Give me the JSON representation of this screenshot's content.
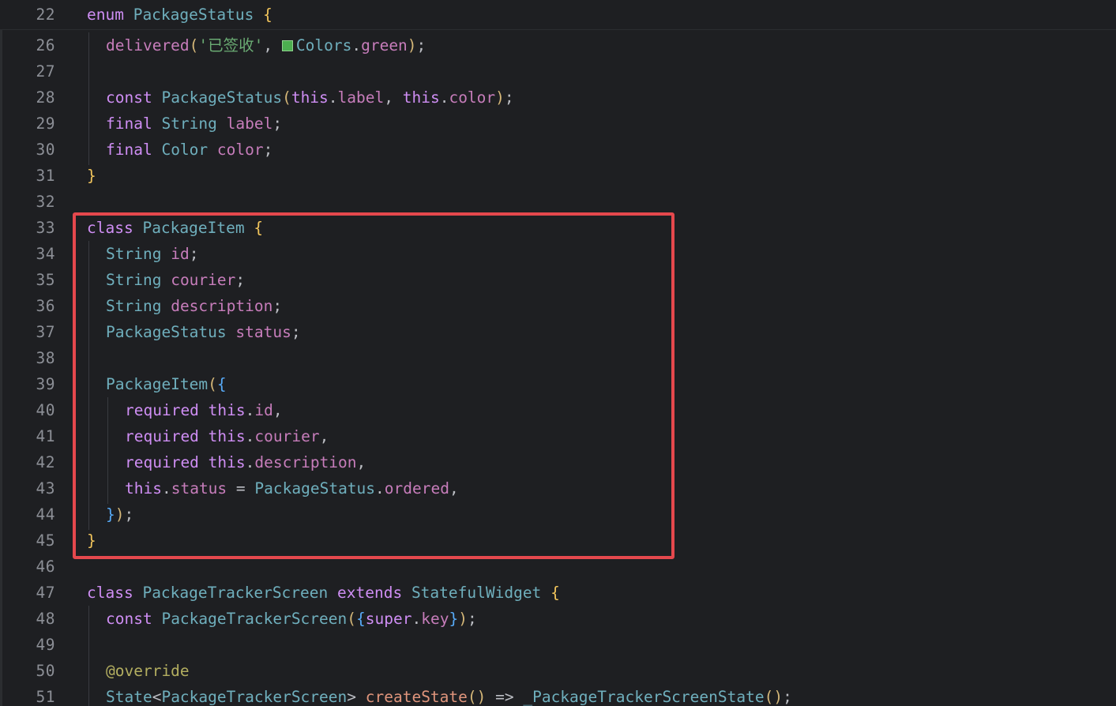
{
  "colors": {
    "background": "#1e1f22",
    "keyword": "#cf8ef4",
    "type": "#6fafbd",
    "string": "#6aab73",
    "field": "#c77dbb",
    "brace": "#f2c55c",
    "paren": "#d5b778",
    "method": "#57aaf7",
    "text": "#bcbec4",
    "function": "#e0957c",
    "annotation": "#b3ae60",
    "line_number": "#8c8f96",
    "highlight_box": "#e5484d",
    "color_swatch": "#4caf50"
  },
  "lines": [
    {
      "num": "22",
      "indent": 0,
      "sticky": true,
      "tokens": [
        {
          "t": "enum ",
          "c": "#cf8ef4"
        },
        {
          "t": "PackageStatus",
          "c": "#6fafbd"
        },
        {
          "t": " ",
          "c": "#bcbec4"
        },
        {
          "t": "{",
          "c": "#f2c55c"
        }
      ]
    },
    {
      "num": "26",
      "indent": 1,
      "tokens": [
        {
          "t": "delivered",
          "c": "#c77dbb"
        },
        {
          "t": "(",
          "c": "#d5b778"
        },
        {
          "t": "'已签收'",
          "c": "#6aab73"
        },
        {
          "t": ", ",
          "c": "#bcbec4"
        },
        {
          "swatch": "#4caf50"
        },
        {
          "t": "Colors",
          "c": "#6fafbd"
        },
        {
          "t": ".",
          "c": "#bcbec4"
        },
        {
          "t": "green",
          "c": "#c77dbb"
        },
        {
          "t": ")",
          "c": "#d5b778"
        },
        {
          "t": ";",
          "c": "#bcbec4"
        }
      ]
    },
    {
      "num": "27",
      "indent": 1,
      "tokens": []
    },
    {
      "num": "28",
      "indent": 1,
      "tokens": [
        {
          "t": "const ",
          "c": "#cf8ef4"
        },
        {
          "t": "PackageStatus",
          "c": "#6fafbd"
        },
        {
          "t": "(",
          "c": "#d5b778"
        },
        {
          "t": "this",
          "c": "#cf8ef4"
        },
        {
          "t": ".",
          "c": "#bcbec4"
        },
        {
          "t": "label",
          "c": "#c77dbb"
        },
        {
          "t": ", ",
          "c": "#bcbec4"
        },
        {
          "t": "this",
          "c": "#cf8ef4"
        },
        {
          "t": ".",
          "c": "#bcbec4"
        },
        {
          "t": "color",
          "c": "#c77dbb"
        },
        {
          "t": ")",
          "c": "#d5b778"
        },
        {
          "t": ";",
          "c": "#bcbec4"
        }
      ]
    },
    {
      "num": "29",
      "indent": 1,
      "tokens": [
        {
          "t": "final ",
          "c": "#cf8ef4"
        },
        {
          "t": "String",
          "c": "#6fafbd"
        },
        {
          "t": " ",
          "c": "#bcbec4"
        },
        {
          "t": "label",
          "c": "#c77dbb"
        },
        {
          "t": ";",
          "c": "#bcbec4"
        }
      ]
    },
    {
      "num": "30",
      "indent": 1,
      "tokens": [
        {
          "t": "final ",
          "c": "#cf8ef4"
        },
        {
          "t": "Color",
          "c": "#6fafbd"
        },
        {
          "t": " ",
          "c": "#bcbec4"
        },
        {
          "t": "color",
          "c": "#c77dbb"
        },
        {
          "t": ";",
          "c": "#bcbec4"
        }
      ]
    },
    {
      "num": "31",
      "indent": 0,
      "tokens": [
        {
          "t": "}",
          "c": "#f2c55c"
        }
      ]
    },
    {
      "num": "32",
      "indent": 0,
      "tokens": []
    },
    {
      "num": "33",
      "indent": 0,
      "tokens": [
        {
          "t": "class ",
          "c": "#cf8ef4"
        },
        {
          "t": "PackageItem",
          "c": "#6fafbd"
        },
        {
          "t": " ",
          "c": "#bcbec4"
        },
        {
          "t": "{",
          "c": "#f2c55c"
        }
      ]
    },
    {
      "num": "34",
      "indent": 1,
      "tokens": [
        {
          "t": "String",
          "c": "#6fafbd"
        },
        {
          "t": " ",
          "c": "#bcbec4"
        },
        {
          "t": "id",
          "c": "#c77dbb"
        },
        {
          "t": ";",
          "c": "#bcbec4"
        }
      ]
    },
    {
      "num": "35",
      "indent": 1,
      "tokens": [
        {
          "t": "String",
          "c": "#6fafbd"
        },
        {
          "t": " ",
          "c": "#bcbec4"
        },
        {
          "t": "courier",
          "c": "#c77dbb"
        },
        {
          "t": ";",
          "c": "#bcbec4"
        }
      ]
    },
    {
      "num": "36",
      "indent": 1,
      "tokens": [
        {
          "t": "String",
          "c": "#6fafbd"
        },
        {
          "t": " ",
          "c": "#bcbec4"
        },
        {
          "t": "description",
          "c": "#c77dbb"
        },
        {
          "t": ";",
          "c": "#bcbec4"
        }
      ]
    },
    {
      "num": "37",
      "indent": 1,
      "tokens": [
        {
          "t": "PackageStatus",
          "c": "#6fafbd"
        },
        {
          "t": " ",
          "c": "#bcbec4"
        },
        {
          "t": "status",
          "c": "#c77dbb"
        },
        {
          "t": ";",
          "c": "#bcbec4"
        }
      ]
    },
    {
      "num": "38",
      "indent": 1,
      "tokens": []
    },
    {
      "num": "39",
      "indent": 1,
      "tokens": [
        {
          "t": "PackageItem",
          "c": "#6fafbd"
        },
        {
          "t": "(",
          "c": "#d5b778"
        },
        {
          "t": "{",
          "c": "#57aaf7"
        }
      ]
    },
    {
      "num": "40",
      "indent": 2,
      "tokens": [
        {
          "t": "required ",
          "c": "#cf8ef4"
        },
        {
          "t": "this",
          "c": "#cf8ef4"
        },
        {
          "t": ".",
          "c": "#bcbec4"
        },
        {
          "t": "id",
          "c": "#c77dbb"
        },
        {
          "t": ",",
          "c": "#bcbec4"
        }
      ]
    },
    {
      "num": "41",
      "indent": 2,
      "tokens": [
        {
          "t": "required ",
          "c": "#cf8ef4"
        },
        {
          "t": "this",
          "c": "#cf8ef4"
        },
        {
          "t": ".",
          "c": "#bcbec4"
        },
        {
          "t": "courier",
          "c": "#c77dbb"
        },
        {
          "t": ",",
          "c": "#bcbec4"
        }
      ]
    },
    {
      "num": "42",
      "indent": 2,
      "tokens": [
        {
          "t": "required ",
          "c": "#cf8ef4"
        },
        {
          "t": "this",
          "c": "#cf8ef4"
        },
        {
          "t": ".",
          "c": "#bcbec4"
        },
        {
          "t": "description",
          "c": "#c77dbb"
        },
        {
          "t": ",",
          "c": "#bcbec4"
        }
      ]
    },
    {
      "num": "43",
      "indent": 2,
      "tokens": [
        {
          "t": "this",
          "c": "#cf8ef4"
        },
        {
          "t": ".",
          "c": "#bcbec4"
        },
        {
          "t": "status",
          "c": "#c77dbb"
        },
        {
          "t": " = ",
          "c": "#bcbec4"
        },
        {
          "t": "PackageStatus",
          "c": "#6fafbd"
        },
        {
          "t": ".",
          "c": "#bcbec4"
        },
        {
          "t": "ordered",
          "c": "#c77dbb"
        },
        {
          "t": ",",
          "c": "#bcbec4"
        }
      ]
    },
    {
      "num": "44",
      "indent": 1,
      "tokens": [
        {
          "t": "}",
          "c": "#57aaf7"
        },
        {
          "t": ")",
          "c": "#d5b778"
        },
        {
          "t": ";",
          "c": "#bcbec4"
        }
      ]
    },
    {
      "num": "45",
      "indent": 0,
      "tokens": [
        {
          "t": "}",
          "c": "#f2c55c"
        }
      ]
    },
    {
      "num": "46",
      "indent": 0,
      "tokens": []
    },
    {
      "num": "47",
      "indent": 0,
      "tokens": [
        {
          "t": "class ",
          "c": "#cf8ef4"
        },
        {
          "t": "PackageTrackerScreen",
          "c": "#6fafbd"
        },
        {
          "t": " extends ",
          "c": "#cf8ef4"
        },
        {
          "t": "StatefulWidget",
          "c": "#6fafbd"
        },
        {
          "t": " ",
          "c": "#bcbec4"
        },
        {
          "t": "{",
          "c": "#f2c55c"
        }
      ]
    },
    {
      "num": "48",
      "indent": 1,
      "tokens": [
        {
          "t": "const ",
          "c": "#cf8ef4"
        },
        {
          "t": "PackageTrackerScreen",
          "c": "#6fafbd"
        },
        {
          "t": "(",
          "c": "#d5b778"
        },
        {
          "t": "{",
          "c": "#57aaf7"
        },
        {
          "t": "super",
          "c": "#cf8ef4"
        },
        {
          "t": ".",
          "c": "#bcbec4"
        },
        {
          "t": "key",
          "c": "#c77dbb"
        },
        {
          "t": "}",
          "c": "#57aaf7"
        },
        {
          "t": ")",
          "c": "#d5b778"
        },
        {
          "t": ";",
          "c": "#bcbec4"
        }
      ]
    },
    {
      "num": "49",
      "indent": 1,
      "tokens": []
    },
    {
      "num": "50",
      "indent": 1,
      "tokens": [
        {
          "t": "@override",
          "c": "#b3ae60"
        }
      ]
    },
    {
      "num": "51",
      "indent": 1,
      "tokens": [
        {
          "t": "State",
          "c": "#6fafbd"
        },
        {
          "t": "<",
          "c": "#bcbec4"
        },
        {
          "t": "PackageTrackerScreen",
          "c": "#6fafbd"
        },
        {
          "t": "> ",
          "c": "#bcbec4"
        },
        {
          "t": "createState",
          "c": "#e0957c"
        },
        {
          "t": "()",
          "c": "#d5b778"
        },
        {
          "t": " => ",
          "c": "#bcbec4"
        },
        {
          "t": "_PackageTrackerScreenState",
          "c": "#6fafbd"
        },
        {
          "t": "()",
          "c": "#d5b778"
        },
        {
          "t": ";",
          "c": "#bcbec4"
        }
      ]
    }
  ]
}
